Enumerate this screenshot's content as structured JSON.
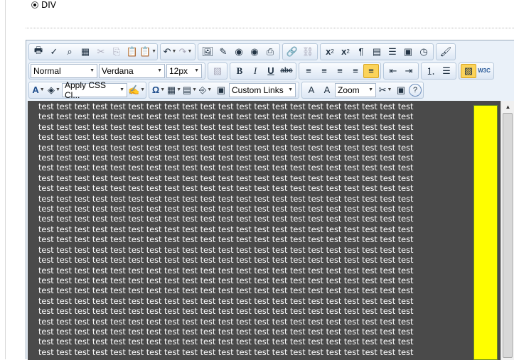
{
  "option": {
    "label": "DIV",
    "selected": true
  },
  "toolbar": {
    "paragraph_style": "Normal",
    "font_name": "Verdana",
    "font_size": "12px",
    "css_class": "Apply CSS Cl...",
    "links": "Custom Links",
    "zoom": "Zoom"
  },
  "icons": {
    "print": "🖶",
    "spell": "✓",
    "find": "⌕",
    "select_all": "▦",
    "cut": "✂",
    "copy": "⎘",
    "paste": "📋",
    "paste_special": "📋",
    "undo": "↶",
    "redo": "↷",
    "image": "🖼",
    "flash": "✎",
    "media": "◉",
    "document": "⎙",
    "link": "🔗",
    "unlink": "⛓",
    "superscript_base": "x",
    "superscript_mark": "2",
    "subscript_base": "x",
    "subscript_mark": "2",
    "paragraph": "¶",
    "template": "▤",
    "hr": "☰",
    "module": "▣",
    "time": "◷",
    "format_painter": "🖌",
    "bold": "B",
    "italic": "I",
    "underline": "U",
    "strike": "abc",
    "align_left": "≡",
    "align_center": "≡",
    "align_right": "≡",
    "justify": "≡",
    "justify_none": "≡",
    "indent": "⇥",
    "outdent": "⇤",
    "ordered_list": "⒈",
    "bullet_list": "☰",
    "toggle_border": "▧",
    "w3c": "W3C",
    "fore_color": "A",
    "back_color": "◈",
    "styles": "✍",
    "symbol": "Ω",
    "table": "▦",
    "insert_block": "▤",
    "snippet": "⎆",
    "image_map": "▣",
    "strip_formatting": "A",
    "format_stripper": "A",
    "tools": "✂",
    "help": "?"
  },
  "content": {
    "word": "test",
    "line_count": 25,
    "words_per_line": 21
  },
  "colors": {
    "content_bg": "#4a4a4a",
    "highlight_box": "#ffff00",
    "toolbar_bg": "#eaf1f9"
  }
}
